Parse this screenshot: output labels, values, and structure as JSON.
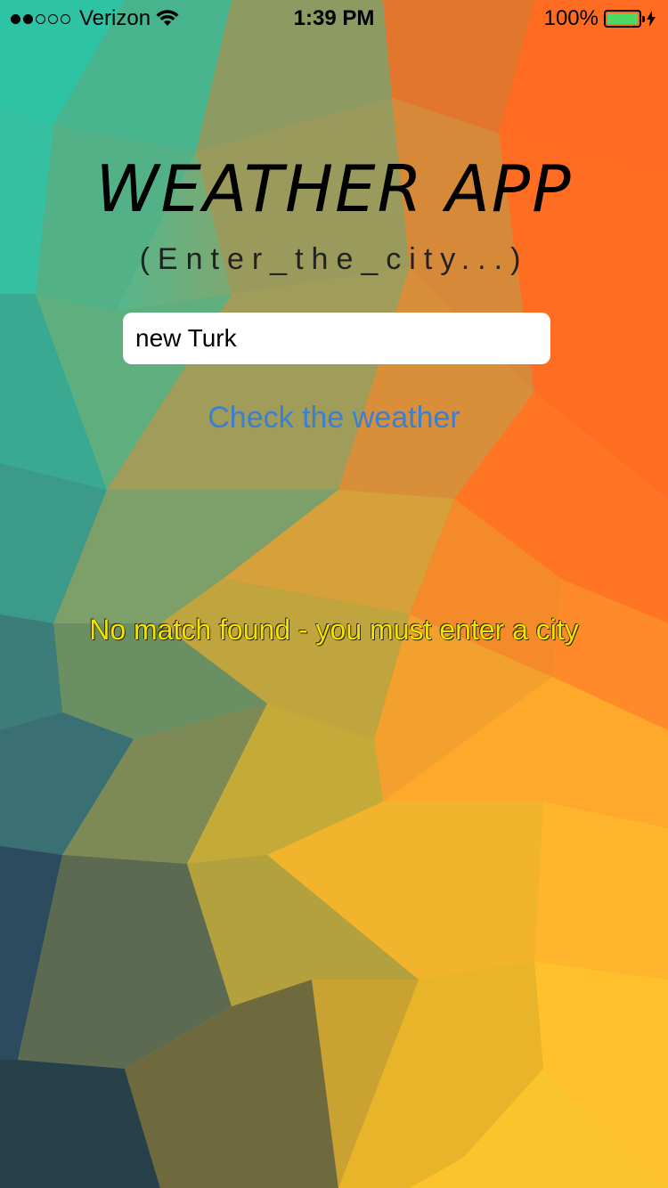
{
  "status_bar": {
    "carrier": "Verizon",
    "time": "1:39 PM",
    "battery_percent": "100%",
    "signal_bars_filled": 2,
    "signal_bars_total": 5
  },
  "app": {
    "title": "WEATHER APP",
    "subtitle": "(Enter_the_city...)"
  },
  "search": {
    "value": "new Turk"
  },
  "actions": {
    "check_label": "Check the weather"
  },
  "result": {
    "message": "No match found - you must enter a city"
  },
  "colors": {
    "accent": "#3a7fd0",
    "error_text": "#f2e400",
    "battery_fill": "#4cd964"
  }
}
